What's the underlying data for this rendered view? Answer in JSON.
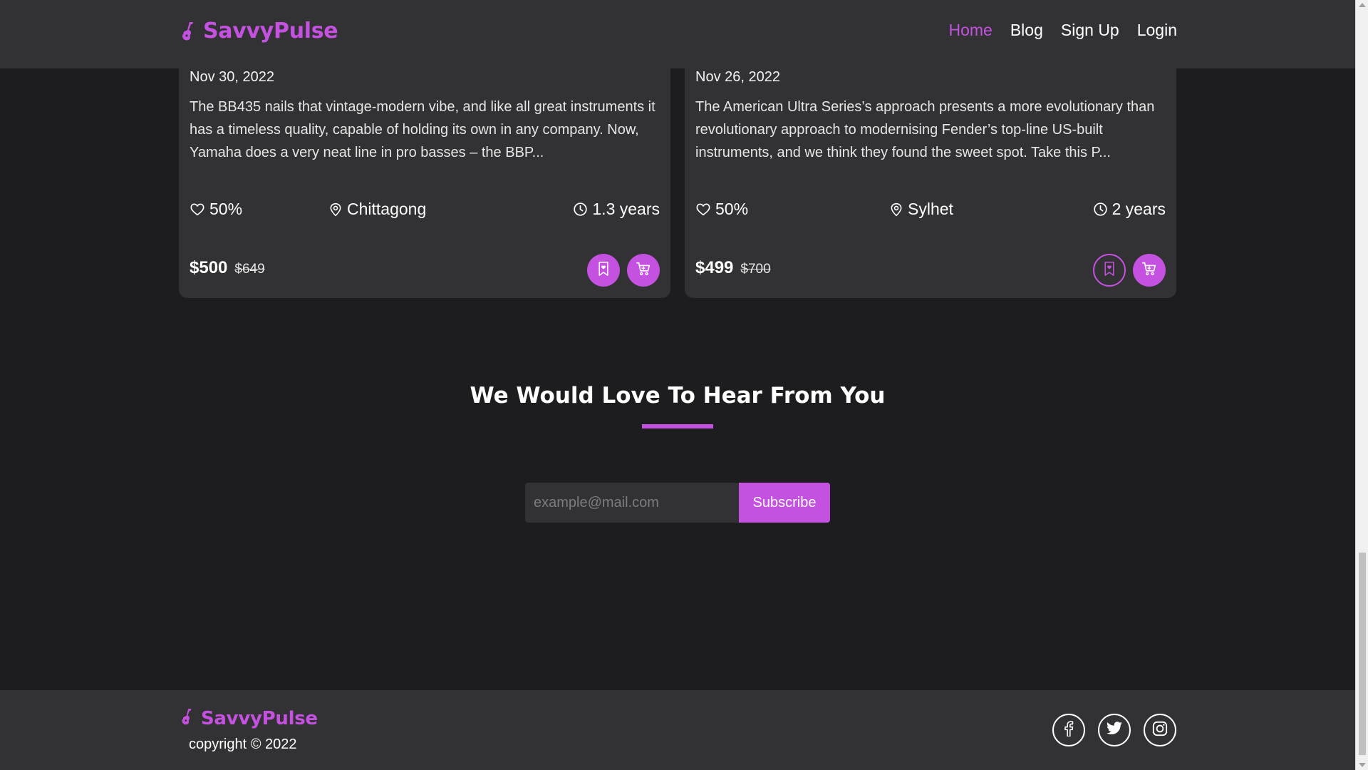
{
  "brand": {
    "name": "SavvyPulse",
    "icon": "guitar-icon",
    "color": "#c451e0"
  },
  "nav": {
    "items": [
      {
        "label": "Home",
        "active": true
      },
      {
        "label": "Blog",
        "active": false
      },
      {
        "label": "Sign Up",
        "active": false
      },
      {
        "label": "Login",
        "active": false
      }
    ]
  },
  "cards": [
    {
      "date": "Nov 30, 2022",
      "description": "The BB435 nails that vintage-modern vibe, and like all great instruments it has a timeless quality, capable of holding its own in any company. Now, Yamaha does a very neat line in pro basses – the BBP...",
      "likes": "50%",
      "location": "Chittagong",
      "usage": "1.3 years",
      "price": "$500",
      "old_price": "$649",
      "bookmark_style": "filled"
    },
    {
      "date": "Nov 26, 2022",
      "description": "The American Ultra Series’s approach presents a more evolutionary than revolutionary approach to modernising Fender’s top-line US-built instruments, and we think they found the sweet spot. Take this P...",
      "likes": "50%",
      "location": "Sylhet",
      "usage": "2 years",
      "price": "$499",
      "old_price": "$700",
      "bookmark_style": "outline"
    }
  ],
  "contact": {
    "title": "We Would Love To Hear From You",
    "email_placeholder": "example@mail.com",
    "subscribe_label": "Subscribe"
  },
  "footer": {
    "brand_name": "SavvyPulse",
    "copyright": "copyright © 2022",
    "social": [
      "facebook-icon",
      "twitter-icon",
      "instagram-icon"
    ]
  },
  "colors": {
    "accent": "#c451e0",
    "background": "#1d1c1f",
    "surface": "#323134"
  }
}
